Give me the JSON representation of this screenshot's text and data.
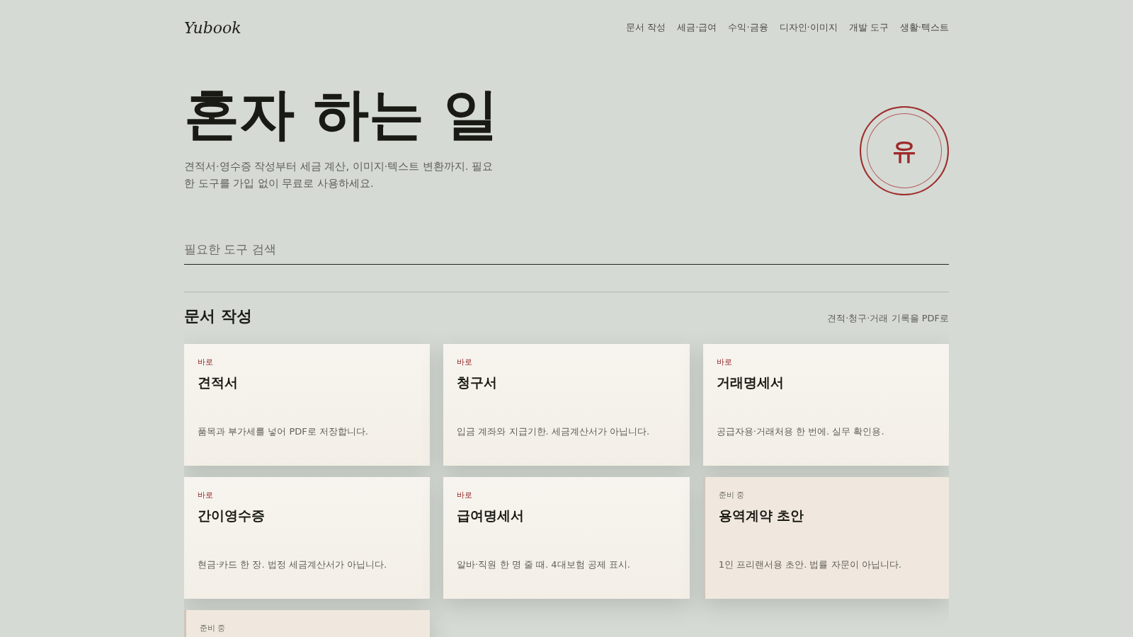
{
  "logo": "Yubook",
  "nav": [
    {
      "label": "문서 작성"
    },
    {
      "label": "세금·급여"
    },
    {
      "label": "수익·금융"
    },
    {
      "label": "디자인·이미지"
    },
    {
      "label": "개발 도구"
    },
    {
      "label": "생활·텍스트"
    }
  ],
  "hero": {
    "title": "혼자 하는 일",
    "subtitle": "견적서·영수증 작성부터 세금 계산, 이미지·텍스트 변환까지. 필요한 도구를 가입 없이 무료로 사용하세요.",
    "seal": "유"
  },
  "search": {
    "placeholder": "필요한 도구 검색"
  },
  "section": {
    "title": "문서 작성",
    "note": "견적·청구·거래 기록을 PDF로",
    "cards": [
      {
        "available": true,
        "badge": "바로",
        "title": "견적서",
        "description": "품목과 부가세를 넣어 PDF로 저장합니다."
      },
      {
        "available": true,
        "badge": "바로",
        "title": "청구서",
        "description": "입금 계좌와 지급기한. 세금계산서가 아닙니다."
      },
      {
        "available": true,
        "badge": "바로",
        "title": "거래명세서",
        "description": "공급자용·거래처용 한 번에. 실무 확인용."
      },
      {
        "available": true,
        "badge": "바로",
        "title": "간이영수증",
        "description": "현금·카드 한 장. 법정 세금계산서가 아닙니다."
      },
      {
        "available": true,
        "badge": "바로",
        "title": "급여명세서",
        "description": "알바·직원 한 명 줄 때. 4대보험 공제 표시."
      },
      {
        "available": false,
        "badge": "준비 중",
        "title": "용역계약 초안",
        "description": "1인 프리랜서용 초안. 법률 자문이 아닙니다."
      },
      {
        "available": false,
        "badge": "준비 중"
      }
    ]
  }
}
